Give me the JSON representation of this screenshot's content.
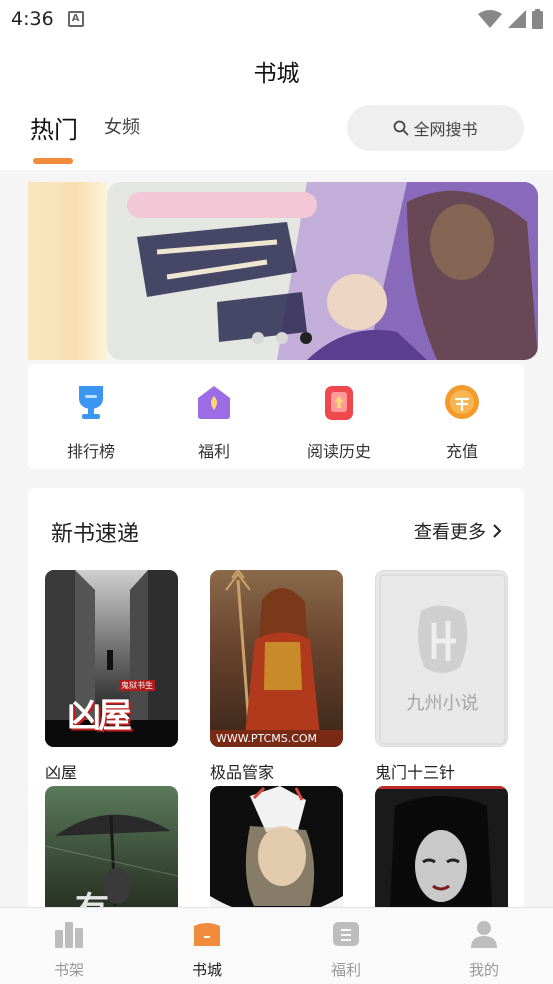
{
  "status_bar": {
    "time": "4:36",
    "notification_badge": "A"
  },
  "header": {
    "title": "书城",
    "tabs": [
      {
        "label": "热门",
        "active": true
      },
      {
        "label": "女频",
        "active": false
      }
    ],
    "search_label": "全网搜书"
  },
  "banner": {
    "page_index": 3,
    "page_count": 3
  },
  "quick_menu": {
    "items": [
      {
        "label": "排行榜",
        "icon": "trophy-icon",
        "color": "#3a96f0"
      },
      {
        "label": "福利",
        "icon": "gift-house-icon",
        "color": "#9c6be6"
      },
      {
        "label": "阅读历史",
        "icon": "history-icon",
        "color": "#f0494d"
      },
      {
        "label": "充值",
        "icon": "coin-icon",
        "color": "#f39a2b"
      }
    ]
  },
  "new_books": {
    "title": "新书速递",
    "more_label": "查看更多",
    "books": [
      {
        "title": "凶屋",
        "cover_text": "凶屋",
        "cover_subtext": "鬼狱书生"
      },
      {
        "title": "极品管家",
        "cover_text": "WWW.PTCMS.COM"
      },
      {
        "title": "鬼门十三针",
        "cover_text": "九州小说"
      },
      {
        "title": "",
        "cover_text": "有"
      },
      {
        "title": "",
        "cover_text": ""
      },
      {
        "title": "",
        "cover_text": ""
      }
    ]
  },
  "bottom_nav": {
    "items": [
      {
        "label": "书架",
        "active": false
      },
      {
        "label": "书城",
        "active": true
      },
      {
        "label": "福利",
        "active": false
      },
      {
        "label": "我的",
        "active": false
      }
    ]
  },
  "colors": {
    "accent": "#f08c3b",
    "inactive": "#999999"
  }
}
